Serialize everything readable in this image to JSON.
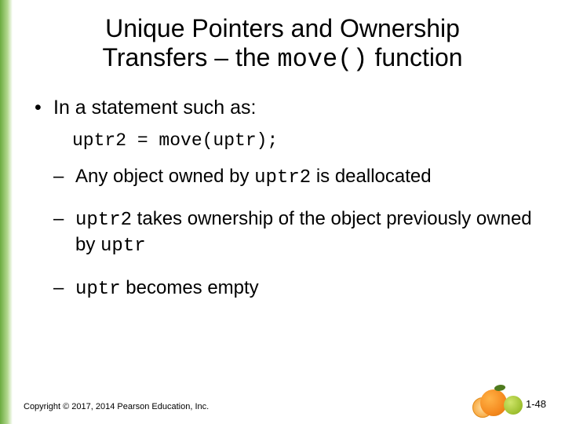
{
  "title": {
    "line1": "Unique Pointers and Ownership",
    "line2_a": "Transfers – the ",
    "line2_mono": "move()",
    "line2_b": " function"
  },
  "bullet1": "In a statement such as:",
  "code": "uptr2 = move(uptr);",
  "sub": [
    {
      "pre": "Any object owned by ",
      "mono": "uptr2",
      "post": " is deallocated"
    },
    {
      "mono1": "uptr2",
      "mid": " takes ownership of the object previously owned by ",
      "mono2": "uptr"
    },
    {
      "mono": "uptr",
      "post": " becomes empty"
    }
  ],
  "copyright": "Copyright © 2017, 2014 Pearson Education, Inc.",
  "pagenum": "1-48"
}
